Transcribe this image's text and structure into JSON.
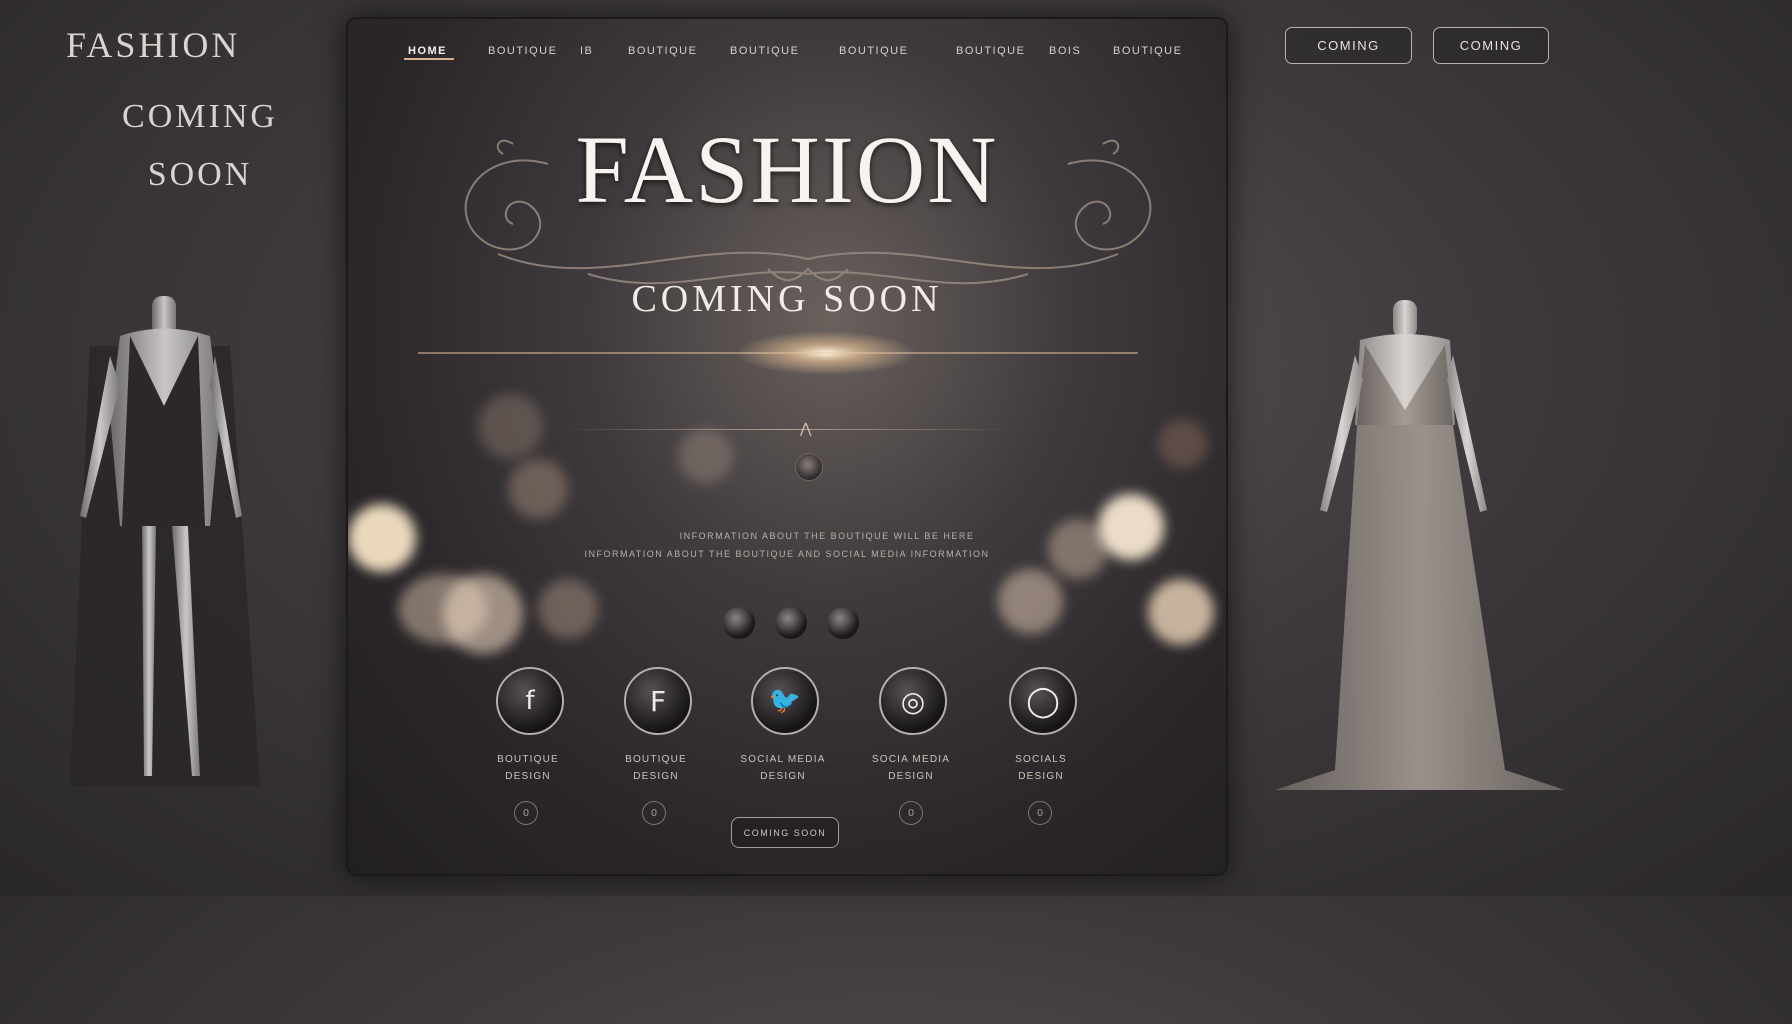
{
  "side": {
    "title": "FASHION",
    "coming": "COMING",
    "soon": "SOON"
  },
  "top_buttons": [
    "COMING",
    "COMING"
  ],
  "nav": {
    "items": [
      "HOME",
      "BOUTIQUE",
      "IB",
      "BOUTIQUE",
      "BOUTIQUE",
      "BOUTIQUE",
      "BOUTIQUE",
      "BOIS",
      "BOUTIQUE"
    ]
  },
  "hero": {
    "title": "FASHION",
    "subtitle": "COMING SOON"
  },
  "blurred_text": {
    "line1": "INFORMATION ABOUT THE BOUTIQUE WILL BE HERE",
    "line2": "INFORMATION ABOUT THE BOUTIQUE AND SOCIAL MEDIA INFORMATION"
  },
  "socials": [
    {
      "icon": "facebook-icon",
      "glyph": "f",
      "label1": "BOUTIQUE",
      "label2": "DESIGN"
    },
    {
      "icon": "facebook-square-icon",
      "glyph": "F",
      "label1": "BOUTIQUE",
      "label2": "DESIGN"
    },
    {
      "icon": "twitter-icon",
      "glyph": "🐦",
      "label1": "SOCIAL MEDIA",
      "label2": "DESIGN"
    },
    {
      "icon": "instagram-icon",
      "glyph": "◎",
      "label1": "SOCIA MEDIA",
      "label2": "DESIGN"
    },
    {
      "icon": "circle-icon",
      "glyph": "◯",
      "label1": "SOCIALS",
      "label2": "DESIGN"
    }
  ],
  "small_ring_glyph": "0",
  "bottom_button": "COMING SOON",
  "colors": {
    "accent": "#d8b28a",
    "panel_dark": "#2a2629",
    "background": "#3e3a3d"
  }
}
